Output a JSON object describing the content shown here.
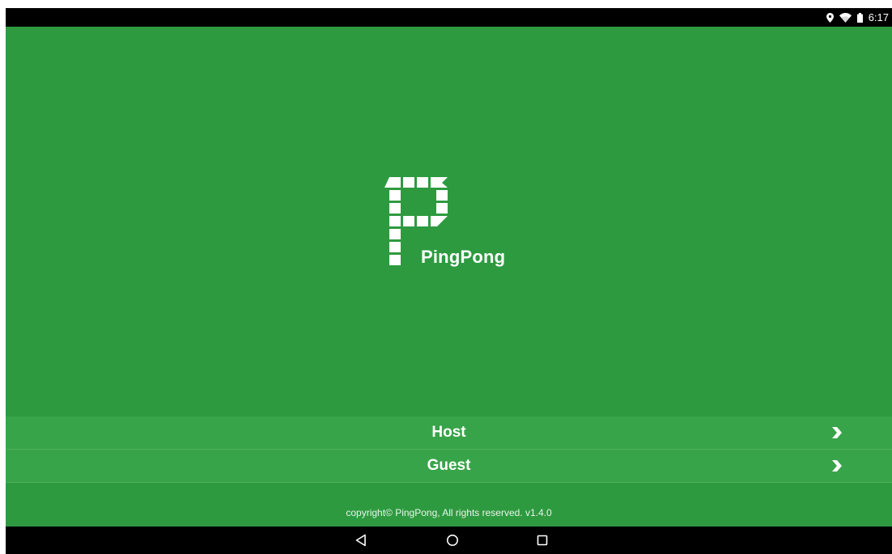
{
  "status_bar": {
    "time": "6:17",
    "icons": [
      "location-icon",
      "wifi-icon",
      "battery-icon"
    ]
  },
  "app": {
    "brand_name": "PingPong",
    "background_color": "#2e9a40",
    "menu": [
      {
        "label": "Host",
        "icon": "chevron-right-icon"
      },
      {
        "label": "Guest",
        "icon": "chevron-right-icon"
      }
    ],
    "copyright": "copyright© PingPong, All rights reserved. v1.4.0"
  },
  "nav_bar": {
    "buttons": [
      "back-icon",
      "home-icon",
      "recents-icon"
    ]
  }
}
